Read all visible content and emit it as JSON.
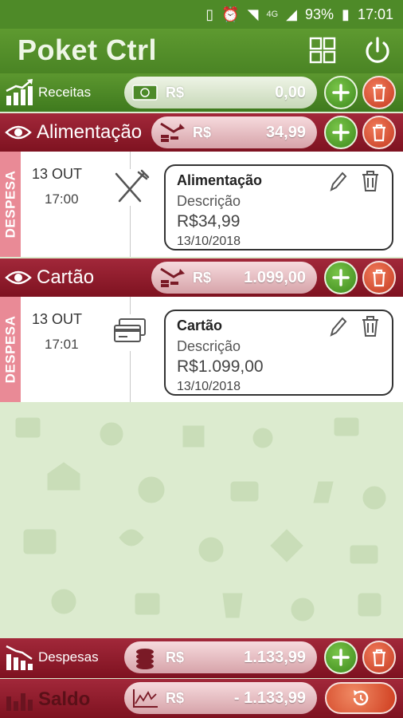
{
  "status_bar": {
    "network": "4G",
    "battery": "93%",
    "time": "17:01"
  },
  "header": {
    "title": "Poket Ctrl"
  },
  "receitas": {
    "label": "Receitas",
    "currency": "R$",
    "value": "0,00"
  },
  "categories": [
    {
      "label": "Alimentação",
      "currency": "R$",
      "value": "34,99",
      "entry": {
        "type_tag": "DESPESA",
        "date": "13 OUT",
        "time": "17:00",
        "icon": "cutlery-icon",
        "title": "Alimentação",
        "description": "Descrição",
        "amount": "R$34,99",
        "full_date": "13/10/2018"
      }
    },
    {
      "label": "Cartão",
      "currency": "R$",
      "value": "1.099,00",
      "entry": {
        "type_tag": "DESPESA",
        "date": "13 OUT",
        "time": "17:01",
        "icon": "credit-card-icon",
        "title": "Cartão",
        "description": "Descrição",
        "amount": "R$1.099,00",
        "full_date": "13/10/2018"
      }
    }
  ],
  "despesas": {
    "label": "Despesas",
    "currency": "R$",
    "value": "1.133,99"
  },
  "saldo": {
    "label": "Saldo",
    "currency": "R$",
    "value": "- 1.133,99"
  },
  "colors": {
    "green": "#4e8a28",
    "red": "#8e1a2a",
    "tag_pink": "#e98a96",
    "background": "#dcebcf"
  }
}
